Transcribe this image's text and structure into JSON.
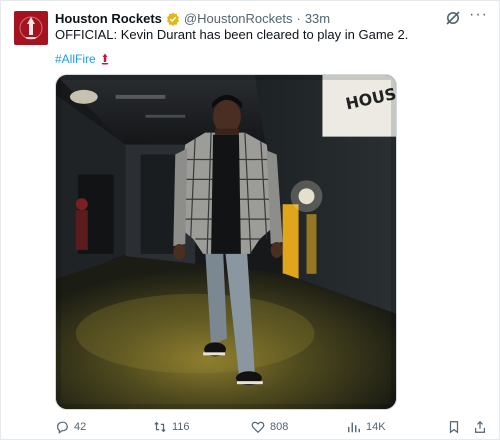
{
  "tweet": {
    "display_name": "Houston Rockets",
    "handle": "@HoustonRockets",
    "separator": "·",
    "time": "33m",
    "text": "OFFICIAL: Kevin Durant has been cleared to play in Game 2.",
    "hashtag": "#AllFire",
    "media_wall_text": "HOUS"
  },
  "actions": {
    "replies": "42",
    "retweets": "116",
    "likes": "808",
    "views": "14K"
  },
  "colors": {
    "brand_red": "#a5131f",
    "link_blue": "#1d9bf0",
    "verified_gold": "#e2b719",
    "muted": "#536471"
  },
  "icons": {
    "avatar": "rockets-logo-icon",
    "verified": "verified-badge-icon",
    "grok": "grok-icon",
    "more": "more-icon",
    "hashtag_emoji": "rockets-emoji-icon",
    "reply": "reply-icon",
    "retweet": "retweet-icon",
    "like": "heart-icon",
    "views": "views-icon",
    "bookmark": "bookmark-icon",
    "share": "share-icon"
  }
}
